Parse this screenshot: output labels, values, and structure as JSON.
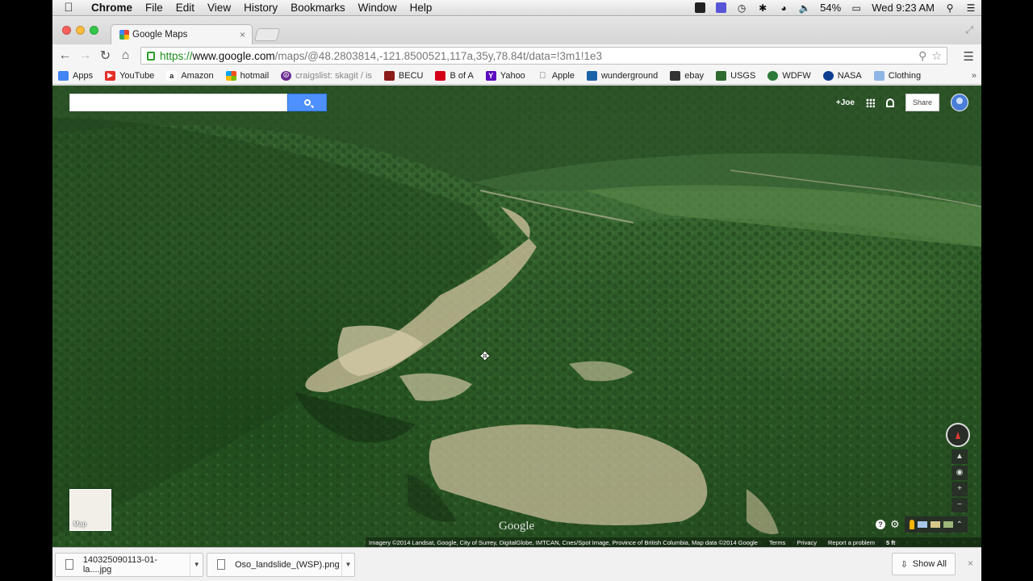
{
  "menubar": {
    "apple": "",
    "items": [
      "Chrome",
      "File",
      "Edit",
      "View",
      "History",
      "Bookmarks",
      "Window",
      "Help"
    ],
    "battery": "54%",
    "clock": "Wed 9:23 AM"
  },
  "tab": {
    "title": "Google Maps",
    "close": "×"
  },
  "address": {
    "scheme": "https://",
    "host": "www.google.com",
    "path": "/maps/@48.2803814,-121.8500521,117a,35y,78.84t/data=!3m1!1e3"
  },
  "bookmarks": [
    {
      "label": "Apps",
      "icon": "apps-grid-icon",
      "color": "#4285f4"
    },
    {
      "label": "YouTube",
      "icon": "youtube-icon",
      "color": "#e52d27"
    },
    {
      "label": "Amazon",
      "icon": "amazon-icon",
      "color": "#222222"
    },
    {
      "label": "hotmail",
      "icon": "windows-icon",
      "color": "#f25022"
    },
    {
      "label": "craigslist: skagit / is",
      "icon": "peace-icon",
      "color": "#6a2c91"
    },
    {
      "label": "BECU",
      "icon": "becu-icon",
      "color": "#8b1c1c"
    },
    {
      "label": "B of A",
      "icon": "bofa-icon",
      "color": "#d4001a"
    },
    {
      "label": "Yahoo",
      "icon": "yahoo-icon",
      "color": "#5c0bbf"
    },
    {
      "label": "Apple",
      "icon": "apple-icon",
      "color": "#555555"
    },
    {
      "label": "wunderground",
      "icon": "wunderground-icon",
      "color": "#1c63a8"
    },
    {
      "label": "ebay",
      "icon": "ebay-icon",
      "color": "#333333"
    },
    {
      "label": "USGS",
      "icon": "usgs-icon",
      "color": "#2f6b2f"
    },
    {
      "label": "WDFW",
      "icon": "wdfw-icon",
      "color": "#2b7a3a"
    },
    {
      "label": "NASA",
      "icon": "nasa-icon",
      "color": "#0b3d91"
    },
    {
      "label": "Clothing",
      "icon": "folder-icon",
      "color": "#8fb5e6"
    }
  ],
  "bookmarks_more": "»",
  "map": {
    "gbar": {
      "plus_user": "+Joe",
      "share": "Share"
    },
    "tile_label": "Map",
    "watermark": "Google",
    "compass_icon": "compass-icon",
    "attribution": "Imagery ©2014 Landsat, Google, City of Surrey, DigitalGlobe, IMTCAN, Cnes/Spot Image, Province of British Columbia, Map data ©2014 Google",
    "links": [
      "Terms",
      "Privacy",
      "Report a problem"
    ],
    "scale": "5 ft"
  },
  "downloads": {
    "items": [
      {
        "name": "140325090113-01-la....jpg"
      },
      {
        "name": "Oso_landslide_(WSP).png"
      }
    ],
    "show_all": "Show All",
    "close": "×"
  }
}
